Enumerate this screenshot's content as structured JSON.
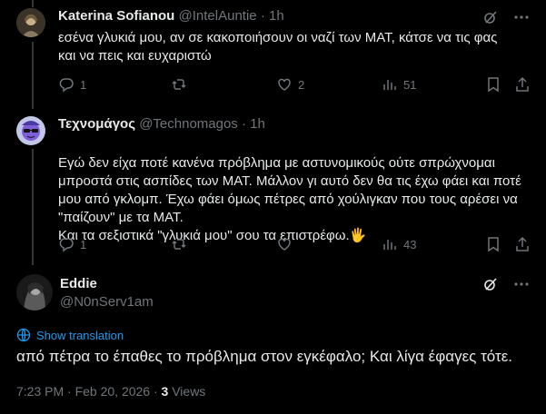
{
  "posts": [
    {
      "name": "Katerina Sofianou",
      "handle": "@IntelAuntie",
      "sep": "·",
      "time": "1h",
      "text": "εσένα γλυκιά μου, αν σε κακοποιήσουν οι ναζί των ΜΑΤ, κάτσε να τις φας και να πεις και ευχαριστώ",
      "replies": "1",
      "reposts": "",
      "likes": "2",
      "views": "51"
    },
    {
      "name": "Τεχνομάγος",
      "handle": "@Technomagos",
      "sep": "·",
      "time": "1h",
      "text": "Εγώ δεν είχα ποτέ κανένα πρόβλημα με αστυνομικούς ούτε σπρώχνομαι μπροστά στις ασπίδες των ΜΑΤ. Μάλλον γι αυτό δεν θα τις έχω φάει και ποτέ μου από γκλομπ. Έχω φάει όμως πέτρες από χούλιγκαν που τους αρέσει να \"παίζουν\" με τα ΜΑΤ.\nΚαι τα σεξιστικά \"γλυκιά μου\" σου τα επιστρέφω.",
      "emoji": "🖐",
      "replies": "1",
      "reposts": "",
      "likes": "",
      "views": "43"
    }
  ],
  "main_post": {
    "name": "Eddie",
    "handle": "@N0nServ1am",
    "show_translation": "Show translation",
    "text": "από πέτρα το έπαθες το πρόβλημα στον εγκέφαλο; Και λίγα έφαγες τότε.",
    "timestamp": "7:23 PM · Feb 20, 2026 ·",
    "views_count": "3",
    "views_label": "Views"
  },
  "colors": {
    "background": "#000000",
    "text": "#e7e9ea",
    "muted": "#71767b",
    "accent": "#1d9bf0",
    "divider": "#2f3336"
  },
  "icons": [
    "grok-icon",
    "more-icon",
    "reply-icon",
    "repost-icon",
    "like-icon",
    "views-icon",
    "bookmark-icon",
    "share-icon",
    "translate-icon"
  ]
}
